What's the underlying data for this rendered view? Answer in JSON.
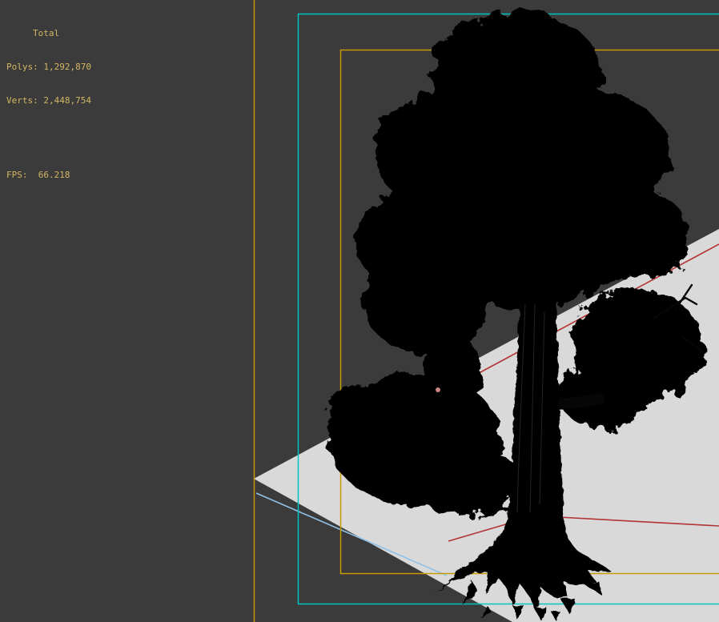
{
  "stats": {
    "total_label": "Total",
    "polys": "Polys: 1,292,870",
    "verts": "Verts: 2,448,754",
    "fps": "FPS:  66.218"
  },
  "colors": {
    "background": "#3b3b3b",
    "stats_text": "#d4b763",
    "separator_line": "#c89600",
    "safe_frame_outer": "#00c3c3",
    "safe_frame_inner": "#c79a00",
    "ground_plane": "#d9d9d9",
    "grid_red": "#b23434",
    "grid_blue": "#8fc1e8",
    "tree": "#060606",
    "vertex_dot": "#cc8585"
  },
  "scene": {
    "object_label": "tree-model",
    "ground_label": "ground-plane"
  }
}
